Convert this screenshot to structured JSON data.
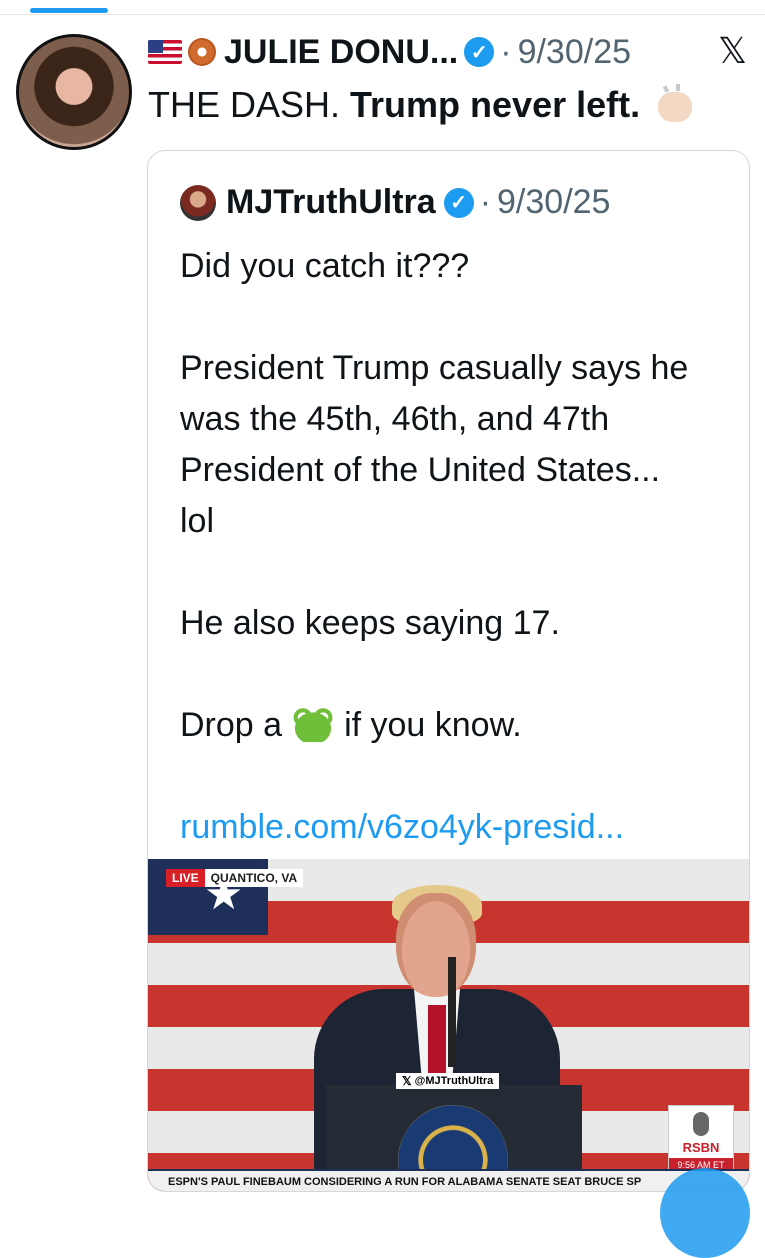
{
  "tweet": {
    "author_name": "JULIE DONU...",
    "date": "9/30/25",
    "text_plain": "THE DASH. ",
    "text_bold": "Trump never left.",
    "icons": [
      "us-flag-icon",
      "donut-icon",
      "verified-icon",
      "x-logo-icon",
      "clapping-hands-icon"
    ]
  },
  "quoted": {
    "author_name": "MJTruthUltra",
    "date": "9/30/25",
    "paragraphs": [
      "Did you catch it???",
      "President Trump casually says he was the 45th, 46th, and 47th President of the United States... lol",
      "He also keeps saying 17."
    ],
    "drop_before": "Drop a",
    "drop_after": "if you know.",
    "link": "rumble.com/v6zo4yk-presid...",
    "media": {
      "live_label": "LIVE",
      "location": "QUANTICO, VA",
      "podium_tag": "@MJTruthUltra",
      "seal_text": "PRESIDENT OF THE UNITED",
      "network": "RSBN",
      "time": "9:56 AM ET",
      "ticker": "ESPN'S PAUL FINEBAUM CONSIDERING A RUN FOR ALABAMA SENATE SEAT    BRUCE SP"
    }
  },
  "colors": {
    "accent": "#1d9bf0",
    "text": "#0f1419",
    "muted": "#536471",
    "border": "#cfd9de"
  }
}
